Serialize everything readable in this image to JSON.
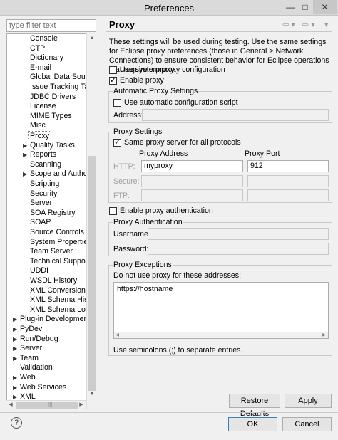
{
  "window": {
    "title": "Preferences",
    "minimize_icon": "—",
    "maximize_icon": "□",
    "close_icon": "✕"
  },
  "filter": {
    "placeholder": "type filter text"
  },
  "tree": {
    "items": [
      {
        "label": "Console",
        "expandable": false
      },
      {
        "label": "CTP",
        "expandable": false
      },
      {
        "label": "Dictionary",
        "expandable": false
      },
      {
        "label": "E-mail",
        "expandable": false
      },
      {
        "label": "Global Data Sources",
        "expandable": false
      },
      {
        "label": "Issue Tracking Tags",
        "expandable": false
      },
      {
        "label": "JDBC Drivers",
        "expandable": false
      },
      {
        "label": "License",
        "expandable": false
      },
      {
        "label": "MIME Types",
        "expandable": false
      },
      {
        "label": "Misc",
        "expandable": false
      },
      {
        "label": "Proxy",
        "expandable": false,
        "selected": true
      },
      {
        "label": "Quality Tasks",
        "expandable": true
      },
      {
        "label": "Reports",
        "expandable": true
      },
      {
        "label": "Scanning",
        "expandable": false
      },
      {
        "label": "Scope and Authorship",
        "expandable": true
      },
      {
        "label": "Scripting",
        "expandable": false
      },
      {
        "label": "Security",
        "expandable": false
      },
      {
        "label": "Server",
        "expandable": false
      },
      {
        "label": "SOA Registry",
        "expandable": false
      },
      {
        "label": "SOAP",
        "expandable": false
      },
      {
        "label": "Source Controls",
        "expandable": false
      },
      {
        "label": "System Properties",
        "expandable": false
      },
      {
        "label": "Team Server",
        "expandable": false
      },
      {
        "label": "Technical Support",
        "expandable": false
      },
      {
        "label": "UDDI",
        "expandable": false
      },
      {
        "label": "WSDL History",
        "expandable": false
      },
      {
        "label": "XML Conversion",
        "expandable": false
      },
      {
        "label": "XML Schema History",
        "expandable": false
      },
      {
        "label": "XML Schema Location",
        "expandable": false
      },
      {
        "label": "Plug-in Development",
        "expandable": true,
        "top": true
      },
      {
        "label": "PyDev",
        "expandable": true,
        "top": true
      },
      {
        "label": "Run/Debug",
        "expandable": true,
        "top": true
      },
      {
        "label": "Server",
        "expandable": true,
        "top": true
      },
      {
        "label": "Team",
        "expandable": true,
        "top": true
      },
      {
        "label": "Validation",
        "expandable": false,
        "top": true
      },
      {
        "label": "Web",
        "expandable": true,
        "top": true
      },
      {
        "label": "Web Services",
        "expandable": true,
        "top": true
      },
      {
        "label": "XML",
        "expandable": true,
        "top": true
      }
    ]
  },
  "page": {
    "title": "Proxy",
    "description": "These settings will be used during testing. Use the same settings for Eclipse proxy preferences (those in General > Network Connections) to ensure consistent behavior for Eclipse operations that require a proxy.",
    "use_system_proxy": {
      "label": "Use system proxy configuration",
      "checked": false
    },
    "enable_proxy": {
      "label": "Enable proxy",
      "checked": true
    },
    "auto_settings": {
      "title": "Automatic Proxy Settings",
      "use_script": {
        "label": "Use automatic configuration script",
        "checked": false
      },
      "address_label": "Address:",
      "address_value": ""
    },
    "proxy_settings": {
      "title": "Proxy Settings",
      "same_proxy": {
        "label": "Same proxy server for all protocols",
        "checked": true
      },
      "col_address": "Proxy Address",
      "col_port": "Proxy Port",
      "rows": [
        {
          "label": "HTTP:",
          "address": "myproxy",
          "port": "912"
        },
        {
          "label": "Secure:",
          "address": "",
          "port": ""
        },
        {
          "label": "FTP:",
          "address": "",
          "port": ""
        }
      ]
    },
    "enable_auth": {
      "label": "Enable proxy authentication",
      "checked": false
    },
    "auth": {
      "title": "Proxy Authentication",
      "username_label": "Username:",
      "password_label": "Password:"
    },
    "exceptions": {
      "title": "Proxy Exceptions",
      "hint": "Do not use proxy for these addresses:",
      "value": "https://hostname",
      "footer": "Use semicolons (;) to separate entries."
    },
    "restore_defaults": "Restore Defaults",
    "apply": "Apply"
  },
  "footer": {
    "help_icon": "?",
    "ok": "OK",
    "cancel": "Cancel"
  }
}
